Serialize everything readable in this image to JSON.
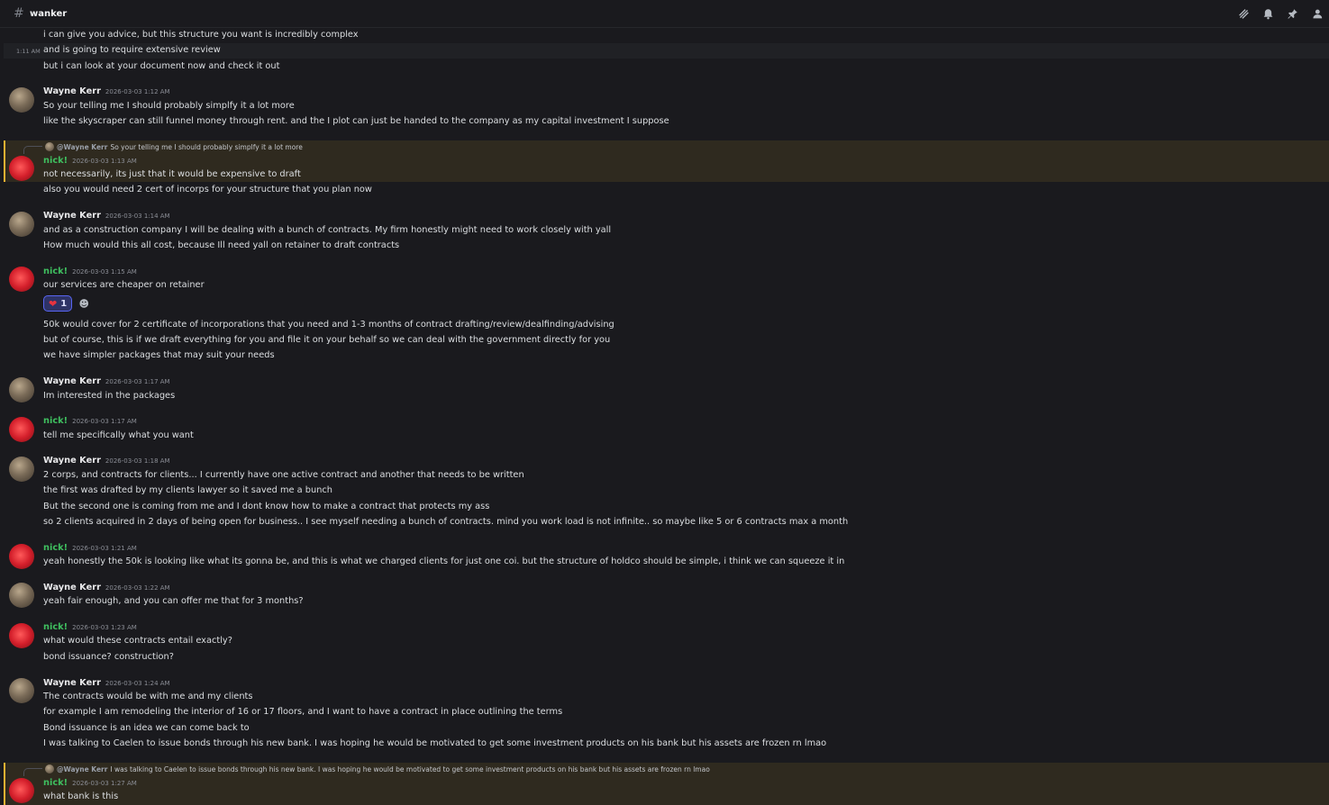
{
  "channel": {
    "title": "wanker"
  },
  "header_icons": [
    "threads-icon",
    "bell-icon",
    "pin-icon",
    "members-icon"
  ],
  "colors": {
    "nick": "#3fbf5f",
    "mention_bar": "#f0b232",
    "background": "#1a1a1e"
  },
  "messages": [
    {
      "lines": [
        "i can give you advice, but this structure you want is incredibly complex"
      ]
    },
    {
      "side_time": "1:11 AM",
      "lines": [
        "and is going to require extensive review"
      ]
    },
    {
      "lines": [
        "but i can look at your document now and check it out"
      ]
    },
    {
      "author": "Wayne Kerr",
      "timestamp": "2026-03-03 1:12 AM",
      "lines": [
        "So your telling me I should probably simplfy it a lot more",
        "like the skyscraper can still funnel money through rent. and the I plot can just be handed to the company as my capital investment I suppose"
      ]
    },
    {
      "reply": {
        "name": "@Wayne Kerr",
        "text": "So your telling me I should probably simplfy it a lot more"
      },
      "author": "nick!",
      "timestamp": "2026-03-03 1:13 AM",
      "lines": [
        "not necessarily, its just that it would be expensive to draft",
        "also you would need 2 cert of incorps for your structure that you plan now"
      ]
    },
    {
      "author": "Wayne Kerr",
      "timestamp": "2026-03-03 1:14 AM",
      "lines": [
        "and as a construction company I will be dealing with a bunch of contracts. My firm honestly might need to work closely with yall",
        "How much would this all cost, because Ill need yall on retainer to draft contracts"
      ]
    },
    {
      "author": "nick!",
      "timestamp": "2026-03-03 1:15 AM",
      "lines": [
        "our services are cheaper on retainer"
      ],
      "reaction": {
        "emoji": "❤",
        "count": "1"
      },
      "lines_after": [
        "50k would cover for 2 certificate of incorporations that you need and 1-3 months of contract drafting/review/dealfinding/advising",
        "but of course, this is if we draft everything for you and file it on your behalf so we can deal with the government directly for you",
        "we have simpler packages that may suit your needs"
      ]
    },
    {
      "author": "Wayne Kerr",
      "timestamp": "2026-03-03 1:17 AM",
      "lines": [
        "Im interested in the packages"
      ]
    },
    {
      "author": "nick!",
      "timestamp": "2026-03-03 1:17 AM",
      "lines": [
        "tell me specifically what you want"
      ]
    },
    {
      "author": "Wayne Kerr",
      "timestamp": "2026-03-03 1:18 AM",
      "lines": [
        "2 corps, and contracts for clients... I currently have one active contract and another that needs to be written",
        "the first was drafted by my clients lawyer so it saved me a bunch",
        "But the second one is coming from me and I dont know how to make a contract that protects my ass",
        "so 2 clients acquired in 2 days of being open for business.. I see myself needing a bunch of contracts. mind you work load is not infinite.. so maybe like 5 or 6 contracts max a month"
      ]
    },
    {
      "author": "nick!",
      "timestamp": "2026-03-03 1:21 AM",
      "lines": [
        "yeah honestly the 50k is looking like what its gonna be, and this is what we charged clients for just one coi. but the structure of holdco should be simple, i think we can squeeze it in"
      ]
    },
    {
      "author": "Wayne Kerr",
      "timestamp": "2026-03-03 1:22 AM",
      "lines": [
        "yeah fair enough, and you can offer me that for 3 months?"
      ]
    },
    {
      "author": "nick!",
      "timestamp": "2026-03-03 1:23 AM",
      "lines": [
        "what would these contracts entail exactly?",
        "bond issuance? construction?"
      ]
    },
    {
      "author": "Wayne Kerr",
      "timestamp": "2026-03-03 1:24 AM",
      "lines": [
        "The contracts would be with me and my clients",
        "for example I am remodeling the interior of 16 or 17 floors, and I want to have a contract in place outlining the terms",
        "Bond issuance is an idea we can come back to",
        "I was talking to Caelen to issue bonds through his new bank. I was hoping he would be motivated to get some investment products on his bank but his assets are frozen rn lmao"
      ]
    },
    {
      "reply": {
        "name": "@Wayne Kerr",
        "text": "I was talking to Caelen to issue bonds through his new bank. I was hoping he would be motivated to get some investment products on his bank but his assets are frozen rn lmao"
      },
      "author": "nick!",
      "timestamp": "2026-03-03 1:27 AM",
      "lines": [
        "what bank is this"
      ]
    }
  ]
}
